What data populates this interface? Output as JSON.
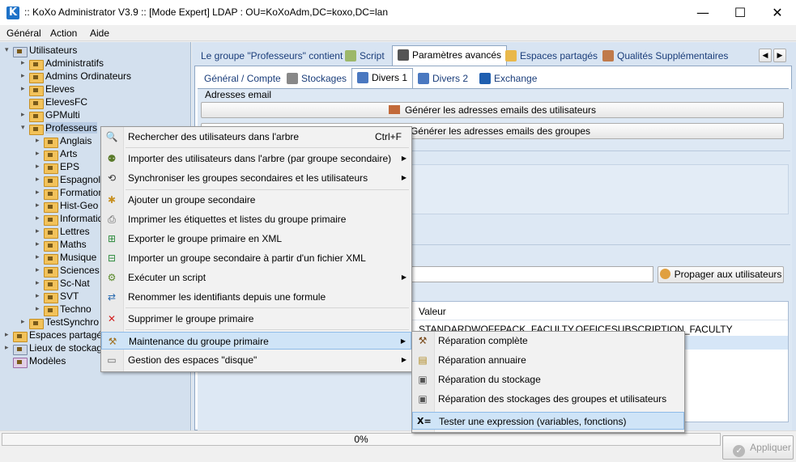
{
  "window": {
    "logo": "K",
    "title": ":: KoXo Administrator V3.9 :: [Mode Expert] LDAP : OU=KoXoAdm,DC=koxo,DC=lan",
    "minimize": "—",
    "maximize": "☐",
    "close": "✕"
  },
  "menubar": [
    "Général",
    "Action",
    "Aide"
  ],
  "tree": {
    "root": "Utilisateurs",
    "groups": [
      "Administratifs",
      "Admins Ordinateurs",
      "Eleves",
      "ElevesFC",
      "GPMulti",
      "Professeurs"
    ],
    "children": [
      "Anglais",
      "Arts",
      "EPS",
      "Espagnol",
      "Formation",
      "Hist-Geo",
      "Informatique",
      "Lettres",
      "Maths",
      "Musique",
      "Sciences",
      "Sc-Nat",
      "SVT",
      "Techno"
    ],
    "after": [
      "TestSynchro"
    ],
    "top_level": [
      "Espaces partagés",
      "Lieux de stockage",
      "Modèles"
    ]
  },
  "tabs_top": [
    {
      "label": "Le groupe \"Professeurs\" contient",
      "icon": "folder-icon"
    },
    {
      "label": "Script",
      "icon": "script-icon"
    },
    {
      "label": "Paramètres avancés",
      "icon": "settings-doc-icon"
    },
    {
      "label": "Espaces partagés",
      "icon": "shared-folder-icon"
    },
    {
      "label": "Qualités Supplémentaires",
      "icon": "users-icon"
    }
  ],
  "tabs_sub": [
    {
      "label": "Général / Compte"
    },
    {
      "label": "Stockages"
    },
    {
      "label": "Divers 1"
    },
    {
      "label": "Divers 2"
    },
    {
      "label": "Exchange"
    }
  ],
  "content": {
    "section_email": "Adresses email",
    "btn_gen_users": "Générer les adresses emails des utilisateurs",
    "btn_gen_groups": "Générer les adresses emails des groupes",
    "btn_propagate": "Propager aux utilisateurs",
    "grid_header": "Valeur",
    "grid_row1": "STANDARDWOFFPACK_FACULTY,OFFICESUBSCRIPTION_FACULTY"
  },
  "context_menu": [
    {
      "label": "Rechercher des utilisateurs dans l'arbre",
      "shortcut": "Ctrl+F",
      "icon": "search-icon",
      "submenu": false
    },
    {
      "label": "Importer des utilisateurs dans l'arbre (par groupe secondaire)",
      "icon": "import-users-icon",
      "submenu": true
    },
    {
      "label": "Synchroniser les groupes secondaires et les utilisateurs",
      "icon": "sync-icon",
      "submenu": true
    },
    {
      "label": "Ajouter un groupe secondaire",
      "icon": "add-group-icon",
      "submenu": false
    },
    {
      "label": "Imprimer les étiquettes et listes du groupe primaire",
      "icon": "printer-icon",
      "submenu": false
    },
    {
      "label": "Exporter le groupe primaire en XML",
      "icon": "export-xml-icon",
      "submenu": false
    },
    {
      "label": "Importer un groupe secondaire à partir d'un fichier XML",
      "icon": "import-xml-icon",
      "submenu": false
    },
    {
      "label": "Exécuter un script",
      "icon": "script-icon",
      "submenu": true
    },
    {
      "label": "Renommer les identifiants depuis une formule",
      "icon": "rename-icon",
      "submenu": false
    },
    {
      "label": "Supprimer le groupe primaire",
      "icon": "delete-icon",
      "submenu": false
    },
    {
      "label": "Maintenance du groupe primaire",
      "icon": "tools-icon",
      "submenu": true
    },
    {
      "label": "Gestion des espaces \"disque\"",
      "icon": "disk-icon",
      "submenu": true
    }
  ],
  "submenu": [
    {
      "label": "Réparation complète",
      "icon": "hammer-icon"
    },
    {
      "label": "Réparation annuaire",
      "icon": "directory-icon"
    },
    {
      "label": "Réparation du stockage",
      "icon": "storage-icon"
    },
    {
      "label": "Réparation des stockages des groupes et utilisateurs",
      "icon": "storage-groups-icon"
    },
    {
      "label": "Tester une expression (variables, fonctions)",
      "icon": "expression-icon"
    }
  ],
  "status": {
    "progress_text": "0%",
    "progress_value": 0,
    "apply_label": "Appliquer"
  },
  "colors": {
    "tree_bg": "#d3e0ee",
    "panel_bg": "#d8e4f2",
    "highlight": "#cfe4f7",
    "logo_blue": "#1e72c8"
  }
}
